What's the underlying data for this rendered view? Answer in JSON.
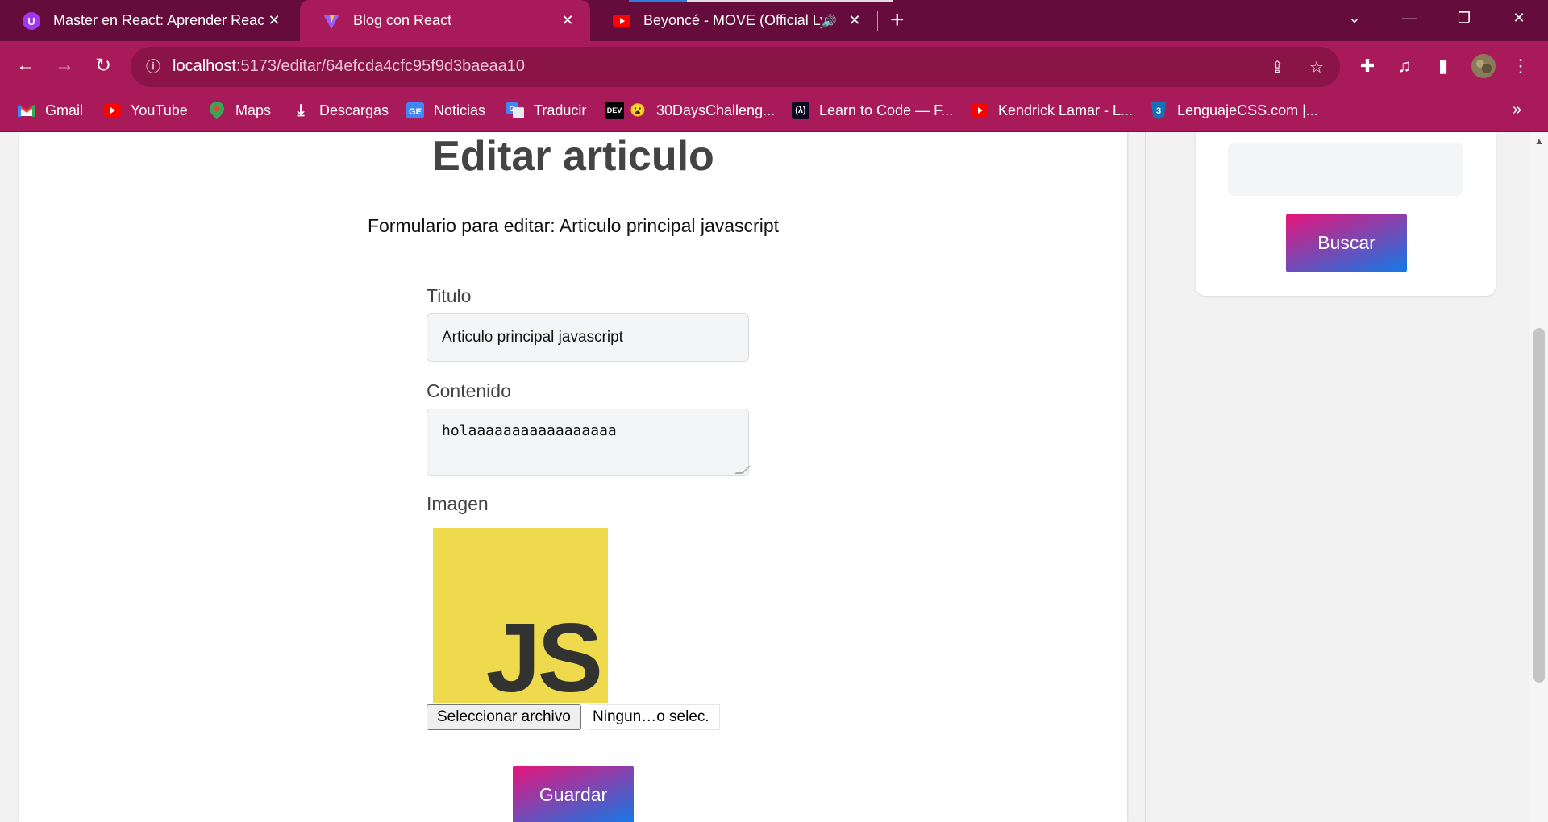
{
  "tabs": [
    {
      "title": "Master en React: Aprender React.js, Hooks",
      "favicon": "udemy-icon",
      "active": false
    },
    {
      "title": "Blog con React",
      "favicon": "vite-icon",
      "active": true
    },
    {
      "title": "Beyoncé - MOVE (Official Lyric",
      "favicon": "youtube-icon",
      "active": false,
      "audio": true
    }
  ],
  "address_bar": {
    "host": "localhost",
    "path": ":5173/editar/64efcda4cfc95f9d3baeaa10"
  },
  "bookmarks": [
    {
      "label": "Gmail",
      "icon": "gmail-icon"
    },
    {
      "label": "YouTube",
      "icon": "youtube-icon"
    },
    {
      "label": "Maps",
      "icon": "maps-icon"
    },
    {
      "label": "Descargas",
      "icon": "download-icon"
    },
    {
      "label": "Noticias",
      "icon": "news-icon"
    },
    {
      "label": "Traducir",
      "icon": "translate-icon"
    },
    {
      "label": "30DaysChalleng...",
      "icon": "dev-icon"
    },
    {
      "label": "Learn to Code — F...",
      "icon": "freecodecamp-icon"
    },
    {
      "label": "Kendrick Lamar - L...",
      "icon": "youtube-icon"
    },
    {
      "label": "LenguajeCSS.com |...",
      "icon": "css3-icon"
    }
  ],
  "page": {
    "title": "Editar articulo",
    "subtitle": "Formulario para editar: Articulo principal javascript",
    "form": {
      "titulo_label": "Titulo",
      "titulo_value": "Articulo principal javascript",
      "contenido_label": "Contenido",
      "contenido_value": "holaaaaaaaaaaaaaaaaa",
      "imagen_label": "Imagen",
      "image_text": "JS",
      "file_button": "Seleccionar archivo",
      "file_status": "Ningun…o selec.",
      "submit": "Guardar"
    }
  },
  "sidebar": {
    "search_button": "Buscar"
  },
  "colors": {
    "tabbar": "#650c3c",
    "toolbar": "#a81a5a",
    "gradient_start": "#e7147a",
    "gradient_end": "#1279e8",
    "js_yellow": "#efd94c"
  }
}
